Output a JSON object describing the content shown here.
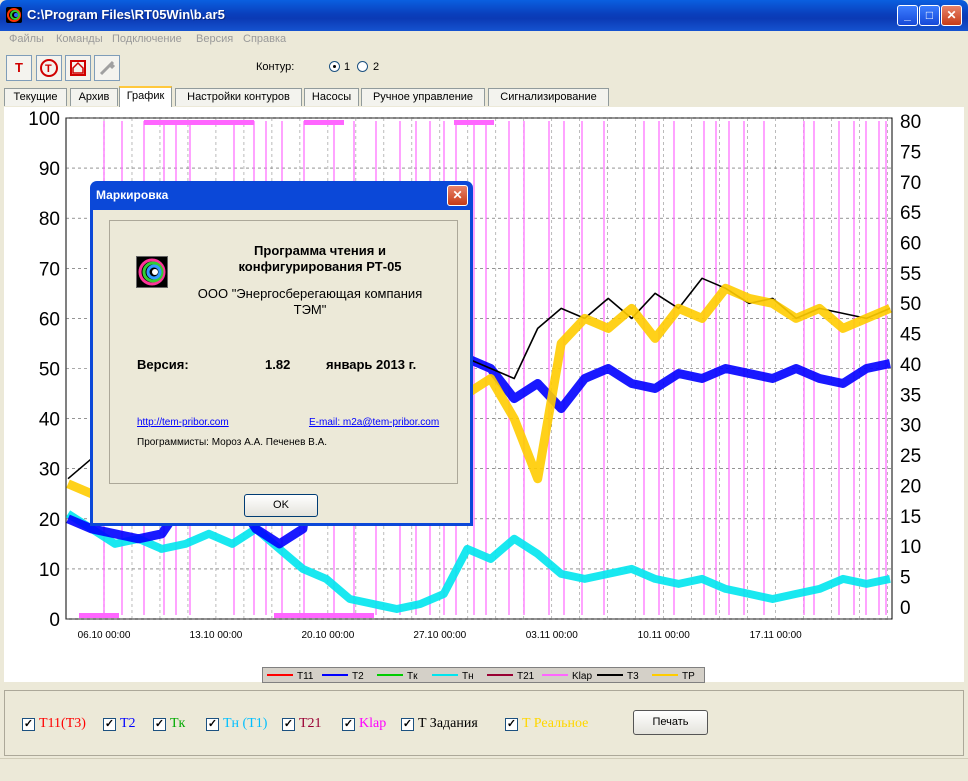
{
  "window": {
    "title": "C:\\Program Files\\RT05Win\\b.ar5",
    "minimize": "_",
    "maximize": "□",
    "close": "✕"
  },
  "menu": [
    "Файлы",
    "Команды",
    "Подключение",
    "Версия",
    "Справка"
  ],
  "toolbar": {
    "contour_label": "Контур:",
    "options": [
      "1",
      "2"
    ],
    "selected": "1"
  },
  "tabs": [
    "Текущие",
    "Архив",
    "График",
    "Настройки контуров",
    "Насосы",
    "Ручное управление",
    "Сигнализирование"
  ],
  "active_tab": "График",
  "chart_data": {
    "type": "line",
    "y_left": {
      "ticks": [
        "0",
        "10",
        "20",
        "30",
        "40",
        "50",
        "60",
        "70",
        "80",
        "90",
        "100"
      ],
      "range": [
        0,
        100
      ]
    },
    "y_right": {
      "ticks": [
        "0",
        "5",
        "10",
        "15",
        "20",
        "25",
        "30",
        "35",
        "40",
        "45",
        "50",
        "55",
        "60",
        "65",
        "70",
        "75",
        "80"
      ],
      "range": [
        0,
        80
      ]
    },
    "x_ticks": [
      "06.10 00:00",
      "13.10 00:00",
      "20.10 00:00",
      "27.10 00:00",
      "03.11 00:00",
      "10.11 00:00",
      "17.11 00:00"
    ],
    "grid": true,
    "legend_placement": "bottom",
    "series": [
      {
        "name": "T11",
        "color": "#ff0000"
      },
      {
        "name": "T2",
        "color": "#0000ff",
        "values": [
          20,
          18,
          17,
          16,
          17,
          24,
          30,
          25,
          18,
          15,
          18,
          55,
          56,
          50,
          48,
          45,
          40,
          52,
          50,
          44,
          47,
          42,
          48,
          50,
          47,
          46,
          49,
          48,
          50,
          49,
          48,
          50,
          48,
          47,
          50,
          51
        ]
      },
      {
        "name": "Tк",
        "color": "#00cc00"
      },
      {
        "name": "Tн",
        "color": "#00e5ee",
        "values": [
          21,
          18,
          15,
          16,
          14,
          15,
          17,
          15,
          18,
          14,
          10,
          8,
          4,
          3,
          2,
          3,
          5,
          14,
          12,
          16,
          13,
          9,
          8,
          9,
          10,
          8,
          7,
          8,
          6,
          5,
          4,
          5,
          6,
          8,
          7,
          8
        ]
      },
      {
        "name": "T21",
        "color": "#990033"
      },
      {
        "name": "Klap",
        "color": "#ff66ff"
      },
      {
        "name": "T3",
        "color": "#000000",
        "values": [
          28,
          32,
          38,
          35,
          33,
          34,
          36,
          40,
          42,
          44,
          46,
          50,
          60,
          68,
          65,
          60,
          55,
          52,
          50,
          48,
          58,
          62,
          60,
          64,
          60,
          65,
          62,
          68,
          66,
          63,
          64,
          60,
          62,
          61,
          60,
          62
        ]
      },
      {
        "name": "TP",
        "color": "#ffcc00",
        "values": [
          27,
          25,
          23,
          22,
          23,
          26,
          30,
          34,
          38,
          45,
          55,
          58,
          66,
          62,
          57,
          55,
          50,
          45,
          48,
          40,
          28,
          55,
          60,
          58,
          62,
          56,
          62,
          60,
          66,
          64,
          63,
          60,
          62,
          58,
          60,
          62
        ]
      }
    ]
  },
  "legend": [
    "T11",
    "T2",
    "Tк",
    "Tн",
    "T21",
    "Klap",
    "T3",
    "TP"
  ],
  "checkboxes": [
    {
      "label": "T11(T3)",
      "color": "#ff0000",
      "checked": true
    },
    {
      "label": "T2",
      "color": "#0000ff",
      "checked": true
    },
    {
      "label": "Tк",
      "color": "#00aa00",
      "checked": true
    },
    {
      "label": "Tн (T1)",
      "color": "#00bfff",
      "checked": true
    },
    {
      "label": "T21",
      "color": "#990033",
      "checked": true
    },
    {
      "label": "Klap",
      "color": "#ff00ff",
      "checked": true
    },
    {
      "label": "T Задания",
      "color": "#000000",
      "checked": true
    },
    {
      "label": "T Реальное",
      "color": "#ffd700",
      "checked": true
    }
  ],
  "print_button": "Печать",
  "dialog": {
    "title": "Маркировка",
    "program_line1": "Программа чтения и",
    "program_line2": "конфигурирования РТ-05",
    "company_line1": "ООО \"Энергосберегающая компания",
    "company_line2": "ТЭМ\"",
    "version_label": "Версия:",
    "version_value": "1.82",
    "version_date": "январь 2013 г.",
    "site_link": "http://tem-pribor.com",
    "email_link": "E-mail: m2a@tem-pribor.com",
    "programmers": "Программисты: Мороз А.А.  Печенев В.А.",
    "ok_button": "OK"
  }
}
